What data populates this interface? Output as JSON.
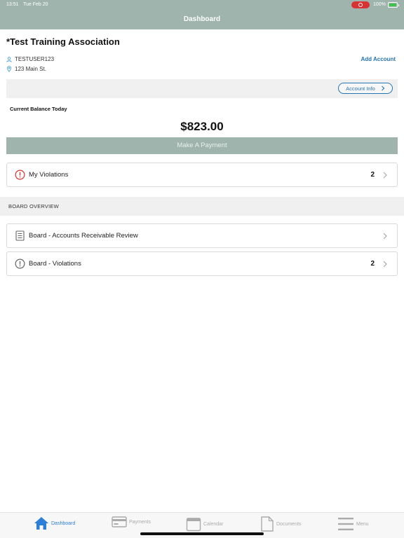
{
  "status_bar": {
    "time": "13:51",
    "date": "Tue Feb 20",
    "battery_percent": "100%",
    "recording_color": "#d83232"
  },
  "nav": {
    "title": "Dashboard"
  },
  "account": {
    "org_name": "*Test Training Association",
    "username": "TESTUSER123",
    "address": "123 Main St.",
    "add_account_label": "Add Account",
    "account_info_label": "Account Info"
  },
  "balance": {
    "label": "Current Balance Today",
    "amount": "$823.00",
    "pay_button_label": "Make A Payment"
  },
  "violations_card": {
    "label": "My Violations",
    "count": "2"
  },
  "board": {
    "section_title": "BOARD OVERVIEW",
    "items": [
      {
        "label": "Board - Accounts Receivable Review",
        "count": "",
        "icon": "document-icon"
      },
      {
        "label": "Board - Violations",
        "count": "2",
        "icon": "exclamation-circle-icon"
      }
    ]
  },
  "tab_bar": {
    "tabs": [
      {
        "label": "Dashboard",
        "icon": "home-icon",
        "active": true
      },
      {
        "label": "Payments",
        "icon": "credit-card-icon",
        "active": false
      },
      {
        "label": "Calendar",
        "icon": "calendar-icon",
        "active": false
      },
      {
        "label": "Documents",
        "icon": "document-icon",
        "active": false
      },
      {
        "label": "Menu",
        "icon": "hamburger-menu-icon",
        "active": false
      }
    ]
  },
  "colors": {
    "header": "#9fb4ad",
    "accent": "#2574b3",
    "active_tab": "#2b7fd6",
    "alert": "#d83232"
  }
}
